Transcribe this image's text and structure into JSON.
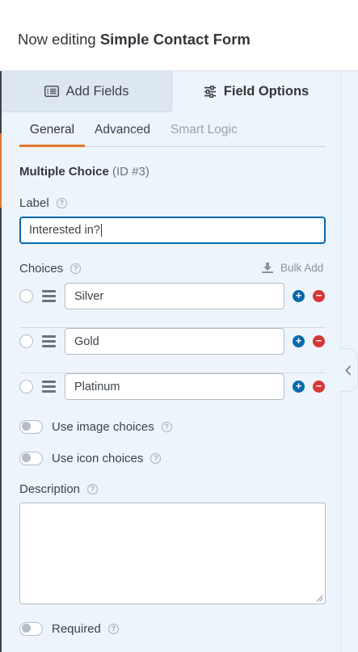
{
  "header": {
    "prefix": "Now editing",
    "form_name": "Simple Contact Form"
  },
  "panel_tabs": {
    "add_fields": "Add Fields",
    "field_options": "Field Options",
    "add_fields_icon": "list-icon",
    "field_options_icon": "sliders-icon"
  },
  "sub_tabs": {
    "general": "General",
    "advanced": "Advanced",
    "smart_logic": "Smart Logic"
  },
  "field": {
    "type": "Multiple Choice",
    "id_text": "(ID #3)"
  },
  "label_section": {
    "label": "Label",
    "value": "Interested in?"
  },
  "choices_section": {
    "label": "Choices",
    "bulk_add": "Bulk Add",
    "items": [
      {
        "value": "Silver"
      },
      {
        "value": "Gold"
      },
      {
        "value": "Platinum"
      }
    ]
  },
  "toggles": {
    "image_choices": "Use image choices",
    "icon_choices": "Use icon choices",
    "required": "Required"
  },
  "description_section": {
    "label": "Description",
    "value": ""
  },
  "colors": {
    "accent_orange": "#e27730",
    "primary_blue": "#036aab",
    "danger_red": "#d63638",
    "panel_bg": "#eef4fb"
  }
}
